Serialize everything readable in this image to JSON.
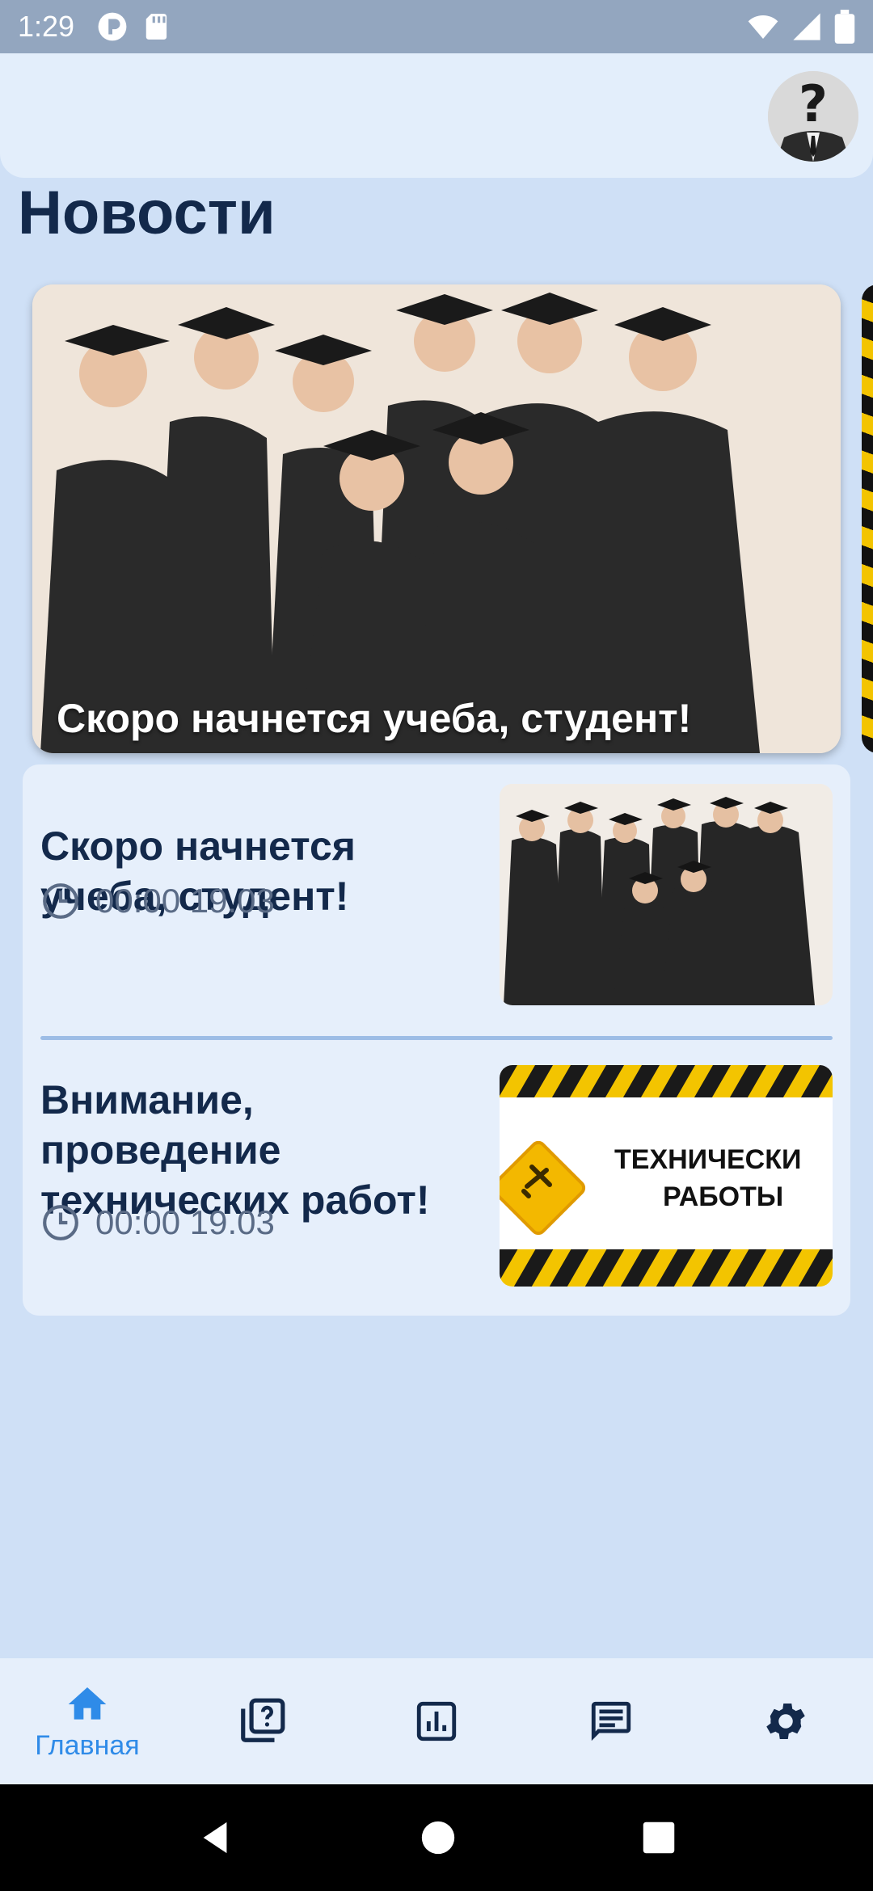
{
  "status_bar": {
    "time": "1:29"
  },
  "page": {
    "title": "Новости"
  },
  "featured": {
    "caption": "Скоро начнется учеба, студент!"
  },
  "news": [
    {
      "title": "Скоро начнется учеба, студент!",
      "time": "00:00 19.03",
      "thumb_icon": "graduates-photo"
    },
    {
      "title": "Внимание, проведение технических работ!",
      "time": "00:00 19.03",
      "thumb_icon": "maintenance-banner",
      "thumb_text_line1": "ТЕХНИЧЕСКИ",
      "thumb_text_line2": "РАБОТЫ"
    }
  ],
  "bottom_nav": {
    "items": [
      {
        "icon": "home-icon",
        "label": "Главная",
        "active": true
      },
      {
        "icon": "quiz-icon",
        "label": ""
      },
      {
        "icon": "stats-icon",
        "label": ""
      },
      {
        "icon": "messages-icon",
        "label": ""
      },
      {
        "icon": "settings-icon",
        "label": ""
      }
    ]
  },
  "colors": {
    "accent": "#2f8be8",
    "title": "#13294b",
    "background": "#cfe0f6"
  }
}
